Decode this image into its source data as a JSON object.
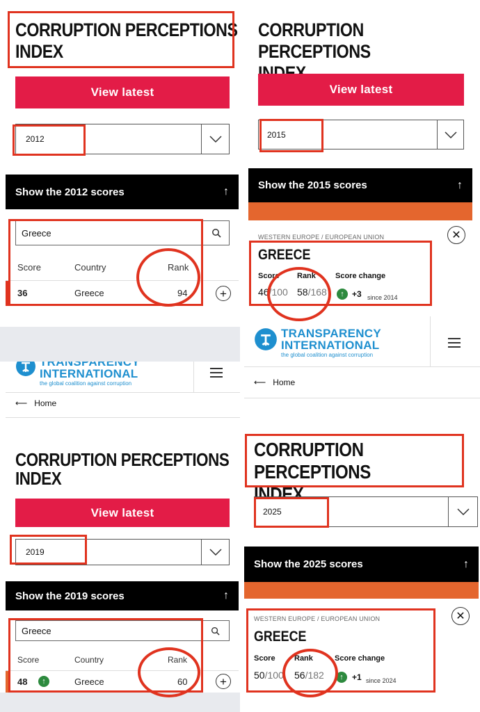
{
  "panel_2012": {
    "title": "CORRUPTION PERCEPTIONS\nINDEX",
    "view_latest": "View latest",
    "year": "2012",
    "show_scores": "Show the 2012 scores",
    "search_value": "Greece",
    "headers": {
      "score": "Score",
      "country": "Country",
      "rank": "Rank"
    },
    "row": {
      "score": "36",
      "country": "Greece",
      "rank": "94"
    }
  },
  "panel_2015": {
    "title": "CORRUPTION PERCEPTIONS\nINDEX",
    "view_latest": "View latest",
    "year": "2015",
    "show_scores": "Show the 2015 scores",
    "region": "WESTERN EUROPE / EUROPEAN UNION",
    "country": "GREECE",
    "score_label": "Score",
    "rank_label": "Rank",
    "change_label": "Score change",
    "score_num": "46",
    "score_den": "/100",
    "rank_num": "58",
    "rank_den": "/168",
    "change_value": "+3",
    "since": "since 2014"
  },
  "panel_2019": {
    "logo_name": "TRANSPARENCY\nINTERNATIONAL",
    "logo_tagline": "the global coalition against corruption",
    "home": "Home",
    "title": "CORRUPTION PERCEPTIONS\nINDEX",
    "view_latest": "View latest",
    "year": "2019",
    "show_scores": "Show the 2019 scores",
    "search_value": "Greece",
    "headers": {
      "score": "Score",
      "country": "Country",
      "rank": "Rank"
    },
    "row": {
      "score": "48",
      "country": "Greece",
      "rank": "60"
    }
  },
  "panel_2025": {
    "logo_name": "TRANSPARENCY\nINTERNATIONAL",
    "logo_tagline": "the global coalition against corruption",
    "home": "Home",
    "title": "CORRUPTION PERCEPTIONS\nINDEX",
    "year": "2025",
    "show_scores": "Show the 2025 scores",
    "region": "WESTERN EUROPE / EUROPEAN UNION",
    "country": "GREECE",
    "score_label": "Score",
    "rank_label": "Rank",
    "change_label": "Score change",
    "score_num": "50",
    "score_den": "/100",
    "rank_num": "56",
    "rank_den": "/182",
    "change_value": "+1",
    "since": "since 2024"
  },
  "colors": {
    "accent_red": "#e31c47",
    "orange": "#e4662e",
    "annotation_red": "#e0331f",
    "ti_blue": "#1e8fcf",
    "up_green": "#2d8a3e"
  }
}
